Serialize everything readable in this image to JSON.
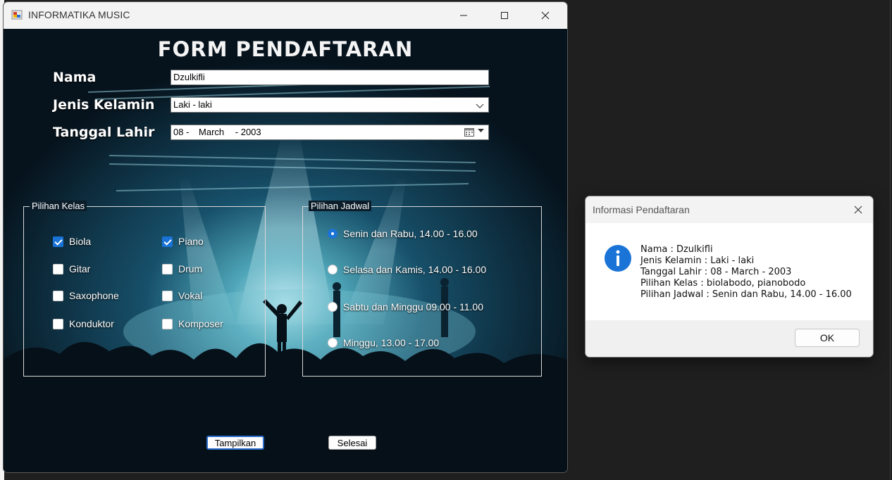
{
  "window": {
    "title": "INFORMATIKA MUSIC",
    "minimize_glyph": "—",
    "maximize_glyph": "☐",
    "close_glyph": "✕"
  },
  "form": {
    "title": "FORM PENDAFTARAN",
    "nama_label": "Nama",
    "nama_value": "Dzulkifli",
    "jenis_kelamin_label": "Jenis Kelamin",
    "jenis_kelamin_value": "Laki - laki",
    "tanggal_lahir_label": "Tanggal Lahir",
    "tanggal_day": "08 -",
    "tanggal_month": "March",
    "tanggal_year": "- 2003"
  },
  "pilihan_kelas": {
    "legend": "Pilihan Kelas",
    "options": [
      {
        "label": "Biola",
        "checked": true
      },
      {
        "label": "Piano",
        "checked": true
      },
      {
        "label": "Gitar",
        "checked": false
      },
      {
        "label": "Drum",
        "checked": false
      },
      {
        "label": "Saxophone",
        "checked": false
      },
      {
        "label": "Vokal",
        "checked": false
      },
      {
        "label": "Konduktor",
        "checked": false
      },
      {
        "label": "Komposer",
        "checked": false
      }
    ]
  },
  "pilihan_jadwal": {
    "legend": "Pilihan Jadwal",
    "options": [
      {
        "label": "Senin dan Rabu, 14.00 - 16.00",
        "selected": true
      },
      {
        "label": "Selasa dan Kamis, 14.00 - 16.00",
        "selected": false
      },
      {
        "label": "Sabtu dan Minggu 09.00 - 11.00",
        "selected": false
      },
      {
        "label": "Minggu, 13.00 - 17.00",
        "selected": false
      }
    ]
  },
  "buttons": {
    "tampilkan": "Tampilkan",
    "selesai": "Selesai"
  },
  "dialog": {
    "title": "Informasi Pendaftaran",
    "close_glyph": "✕",
    "lines": [
      "Nama : Dzulkifli",
      "Jenis Kelamin : Laki - laki",
      "Tanggal Lahir : 08 - March - 2003",
      "Pilihan Kelas : biolabodo, pianobodo",
      "Pilihan Jadwal : Senin dan Rabu, 14.00 - 16.00"
    ],
    "ok_label": "OK"
  },
  "colors": {
    "accent": "#1a73d6",
    "window_chrome": "#f3f3f3",
    "background_dark": "#0a1a26"
  }
}
